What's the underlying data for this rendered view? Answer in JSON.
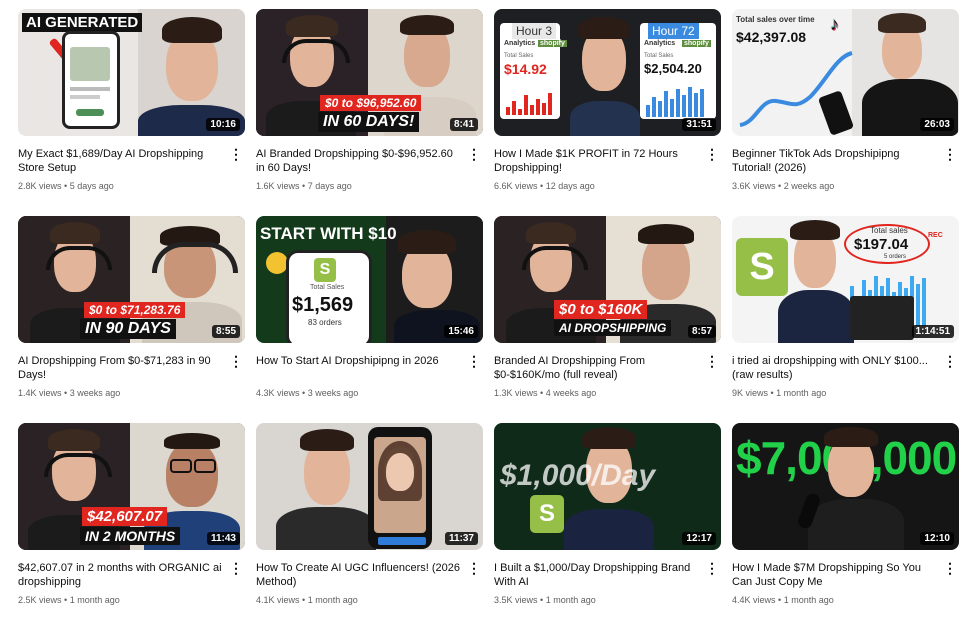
{
  "videos": [
    {
      "title": "My Exact $1,689/Day AI Dropshipping Store Setup",
      "views": "2.8K views",
      "age": "5 days ago",
      "duration": "10:16",
      "overlay": "AI GENERATED"
    },
    {
      "title": "AI Branded Dropshipping $0-$96,952.60 in 60 Days!",
      "views": "1.6K views",
      "age": "7 days ago",
      "duration": "8:41",
      "overlay1": "$0 to $96,952.60",
      "overlay2": "IN 60 DAYS!"
    },
    {
      "title": "How I Made $1K PROFIT in 72 Hours Dropshipping!",
      "views": "6.6K views",
      "age": "12 days ago",
      "duration": "31:51",
      "left_label": "Hour 3",
      "left_value": "$14.92",
      "right_label": "Hour 72",
      "right_value": "$2,504.20",
      "brand": "shopify",
      "analytics": "Analytics",
      "total_sales": "Total Sales"
    },
    {
      "title": "Beginner TikTok Ads Dropshipipng Tutorial! (2026)",
      "views": "3.6K views",
      "age": "2 weeks ago",
      "duration": "26:03",
      "overlay1": "Total sales over time",
      "overlay2": "$42,397.08"
    },
    {
      "title": "AI Dropshipping From $0-$71,283 in 90 Days!",
      "views": "1.4K views",
      "age": "3 weeks ago",
      "duration": "8:55",
      "overlay1": "$0 to $71,283.76",
      "overlay2": "IN 90 DAYS"
    },
    {
      "title": "How To Start AI Dropshipipng in 2026",
      "views": "4.3K views",
      "age": "3 weeks ago",
      "duration": "15:46",
      "overlay1": "START WITH $10",
      "overlay2": "Total Sales",
      "overlay3": "$1,569",
      "overlay4": "83 orders"
    },
    {
      "title": "Branded AI Dropshipping From $0-$160K/mo (full reveal)",
      "views": "1.3K views",
      "age": "4 weeks ago",
      "duration": "8:57",
      "overlay1": "$0 to $160K",
      "overlay2": "AI DROPSHIPPING"
    },
    {
      "title": "i tried ai dropshipping with ONLY $100... (raw results)",
      "views": "9K views",
      "age": "1 month ago",
      "duration": "1:14:51",
      "overlay1": "Total sales",
      "overlay2": "$197.04",
      "overlay3": "5 orders",
      "rec": "REC"
    },
    {
      "title": "$42,607.07 in 2 months with ORGANIC ai dropshipping",
      "views": "2.5K views",
      "age": "1 month ago",
      "duration": "11:43",
      "overlay1": "$42,607.07",
      "overlay2": "IN 2 MONTHS"
    },
    {
      "title": "How To Create AI UGC Influencers! (2026 Method)",
      "views": "4.1K views",
      "age": "1 month ago",
      "duration": "11:37"
    },
    {
      "title": "I Built a $1,000/Day Dropshipping Brand With AI",
      "views": "3.5K views",
      "age": "1 month ago",
      "duration": "12:17",
      "overlay1": "$1,000/Day"
    },
    {
      "title": "How I Made $7M Dropshipping So You Can Just Copy Me",
      "views": "4.4K views",
      "age": "1 month ago",
      "duration": "12:10",
      "overlay1": "$7,000,000"
    }
  ],
  "menu_glyph": "⋮",
  "separator": " • "
}
